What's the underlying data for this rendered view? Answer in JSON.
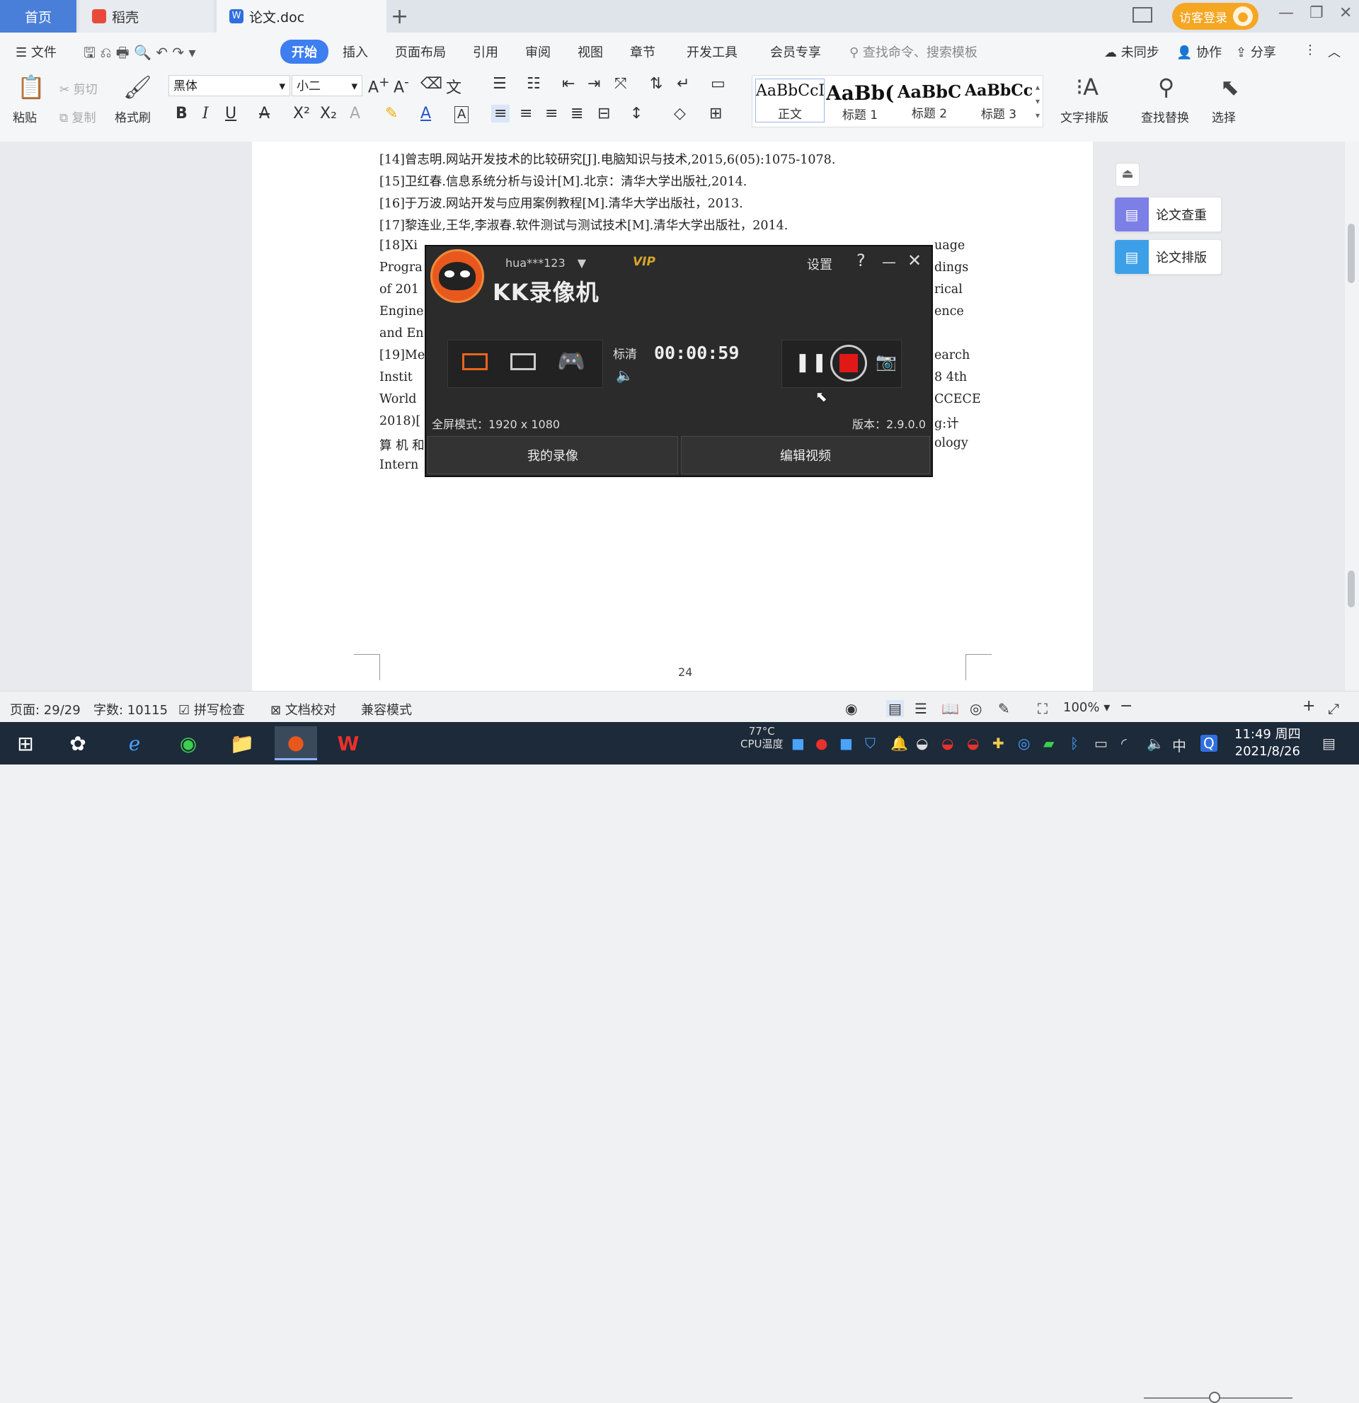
{
  "tabs": {
    "home": "首页",
    "daoke": "稻壳",
    "doc": "论文.doc",
    "new_tab": "+"
  },
  "titlebar": {
    "login": "访客登录"
  },
  "menu": {
    "file": "文件",
    "items": [
      "开始",
      "插入",
      "页面布局",
      "引用",
      "审阅",
      "视图",
      "章节",
      "开发工具",
      "会员专享"
    ],
    "search_placeholder": "查找命令、搜索模板",
    "sync": "未同步",
    "collab": "协作",
    "share": "分享"
  },
  "ribbon": {
    "paste": "粘贴",
    "cut": "剪切",
    "copy": "复制",
    "format_painter": "格式刷",
    "font_name": "黑体",
    "font_size": "小二",
    "styles": [
      {
        "preview": "AaBbCcI",
        "name": "正文"
      },
      {
        "preview": "AaBb(",
        "name": "标题 1"
      },
      {
        "preview": "AaBbC",
        "name": "标题 2"
      },
      {
        "preview": "AaBbCcI",
        "name": "标题 3"
      }
    ],
    "text_layout": "文字排版",
    "find_replace": "查找替换",
    "select": "选择"
  },
  "document": {
    "references": [
      "[14]曾志明.网站开发技术的比较研究[J].电脑知识与技术,2015,6(05):1075-1078.",
      "[15]卫红春.信息系统分析与设计[M].北京：清华大学出版社,2014.",
      "[16]于万波.网站开发与应用案例教程[M].清华大学出版社，2013.",
      "[17]黎连业,王华,李淑春.软件测试与测试技术[M].清华大学出版社，2014.",
      "[18]Xi",
      "Progra",
      "of 201",
      "Engine",
      "and En",
      "[19]Me",
      "Instit",
      "World",
      "2018)[",
      "算 机 和",
      "Intern"
    ],
    "ref_right_fragments": [
      "uage",
      "dings",
      "rical",
      "ence",
      "earch",
      "8 4th",
      "CCECE",
      "g:计",
      "ology"
    ],
    "page_number": "24"
  },
  "side_panel": {
    "check": "论文查重",
    "format": "论文排版"
  },
  "recorder": {
    "app_name": "KK录像机",
    "user": "hua***123",
    "vip": "VIP",
    "settings": "设置",
    "help": "?",
    "quality": "标清",
    "time": "00:00:59",
    "mode_status": "全屏模式：1920 x 1080",
    "version": "版本：2.9.0.0",
    "my_videos": "我的录像",
    "edit_video": "编辑视频"
  },
  "statusbar": {
    "page": "页面: 29/29",
    "word_count": "字数: 10115",
    "spell_check": "拼写检查",
    "doc_check": "文档校对",
    "compat": "兼容模式",
    "zoom": "100%"
  },
  "taskbar": {
    "temp": "77°C",
    "temp_label": "CPU温度",
    "time": "11:49 周四",
    "date": "2021/8/26",
    "ime": "中"
  },
  "colors": {
    "accent": "#3d7ef1",
    "record_red": "#e01818",
    "login_orange": "#f5a623"
  }
}
